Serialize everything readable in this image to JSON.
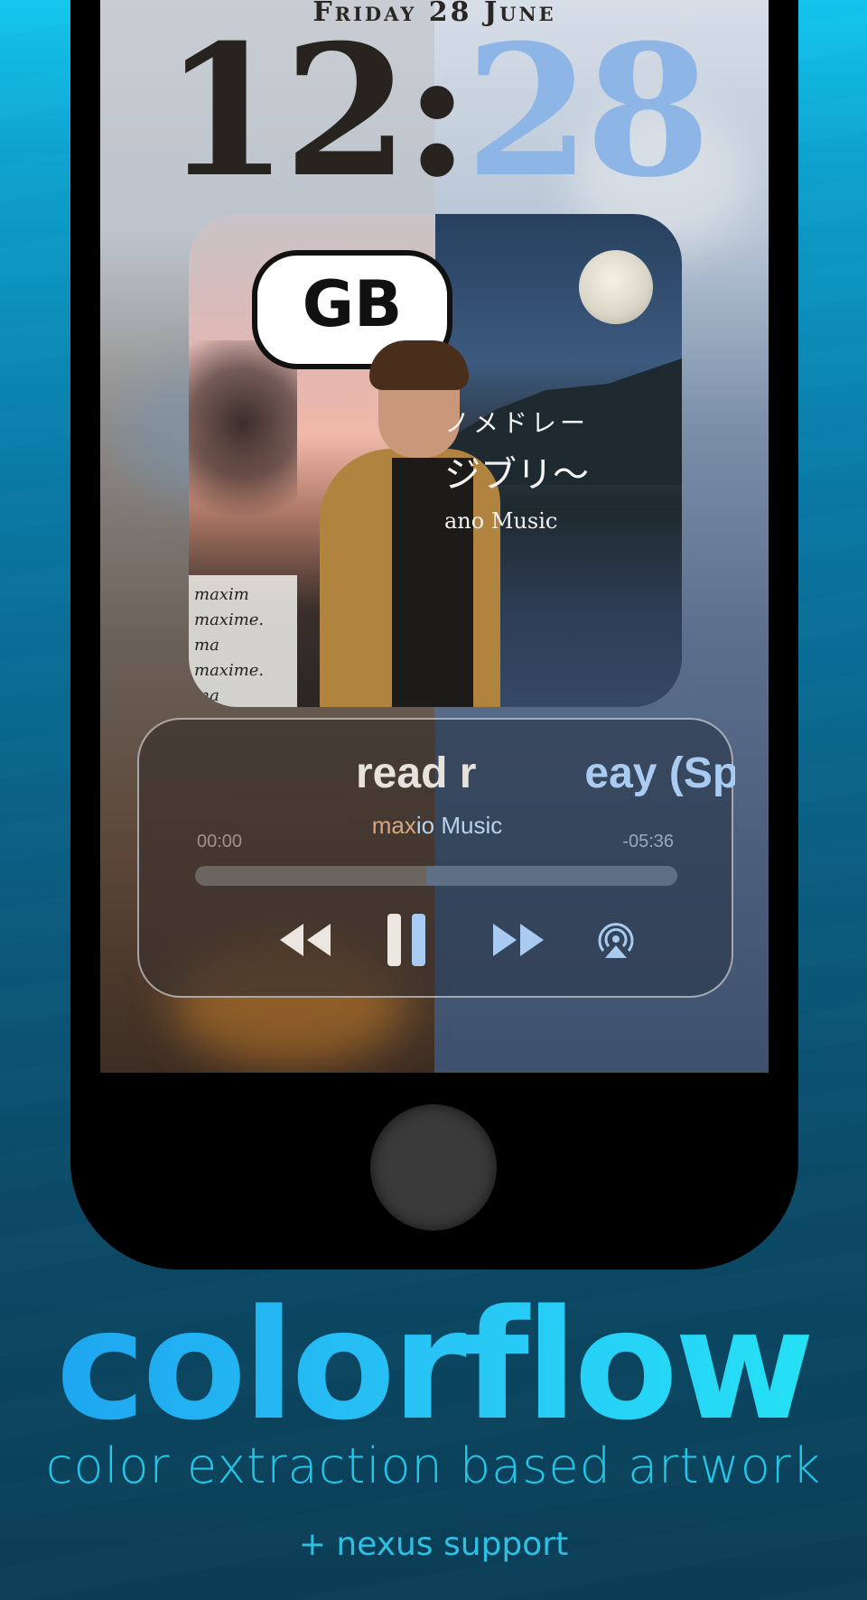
{
  "lockscreen": {
    "date": "Friday 28 June",
    "time_left": "12:",
    "time_right": "28"
  },
  "artwork": {
    "graffiti_text": "GB",
    "jp_line1": "ノメドレー",
    "jp_line2": "ジブリ〜",
    "jp_line3": "ano Music",
    "torn_text": [
      "maxim",
      "maxime. ma",
      "maxime. ma",
      "maxi"
    ]
  },
  "player": {
    "song_left": "read r",
    "song_right": "eay (Spirite",
    "artist_left": "max",
    "artist_right": "io Music",
    "elapsed": "00:00",
    "remaining": "-05:36",
    "progress": 0.0
  },
  "icons": {
    "rewind": "rewind-icon",
    "pause": "pause-icon",
    "forward": "fast-forward-icon",
    "airplay": "airplay-icon"
  },
  "branding": {
    "title": "colorflow",
    "tagline": "color extraction based artwork",
    "subnote": "+ nexus support"
  },
  "colors": {
    "accent_left": "#e8e2dc",
    "accent_right": "#8db6e7",
    "brand_cyan": "#22c7e8"
  }
}
